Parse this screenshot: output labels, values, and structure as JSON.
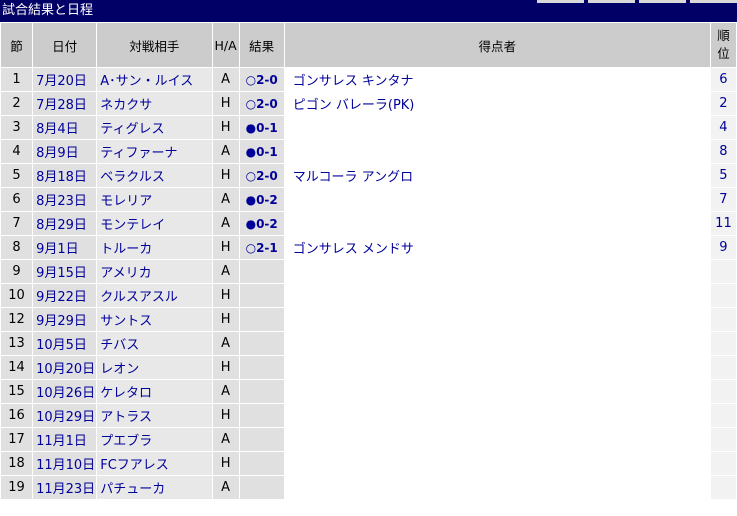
{
  "title": "試合結果と日程",
  "headers": {
    "round": "節",
    "date": "日付",
    "opponent": "対戦相手",
    "ha": "H/A",
    "result": "結果",
    "scorers": "得点者",
    "rank": "順位"
  },
  "rows": [
    {
      "round": "1",
      "date": "7月20日",
      "opponent": "A･サン・ルイス",
      "ha": "A",
      "result": "○2-0",
      "scorers": "ゴンサレス キンタナ",
      "rank": "6"
    },
    {
      "round": "2",
      "date": "7月28日",
      "opponent": "ネカクサ",
      "ha": "H",
      "result": "○2-0",
      "scorers": "ピゴン バレーラ(PK)",
      "rank": "2"
    },
    {
      "round": "3",
      "date": "8月4日",
      "opponent": "ティグレス",
      "ha": "H",
      "result": "●0-1",
      "scorers": "",
      "rank": "4"
    },
    {
      "round": "4",
      "date": "8月9日",
      "opponent": "ティファーナ",
      "ha": "A",
      "result": "●0-1",
      "scorers": "",
      "rank": "8"
    },
    {
      "round": "5",
      "date": "8月18日",
      "opponent": "ベラクルス",
      "ha": "H",
      "result": "○2-0",
      "scorers": "マルコーラ アングロ",
      "rank": "5"
    },
    {
      "round": "6",
      "date": "8月23日",
      "opponent": "モレリア",
      "ha": "A",
      "result": "●0-2",
      "scorers": "",
      "rank": "7"
    },
    {
      "round": "7",
      "date": "8月29日",
      "opponent": "モンテレイ",
      "ha": "A",
      "result": "●0-2",
      "scorers": "",
      "rank": "11"
    },
    {
      "round": "8",
      "date": "9月1日",
      "opponent": "トルーカ",
      "ha": "H",
      "result": "○2-1",
      "scorers": "ゴンサレス メンドサ",
      "rank": "9"
    },
    {
      "round": "9",
      "date": "9月15日",
      "opponent": "アメリカ",
      "ha": "A",
      "result": "",
      "scorers": "",
      "rank": ""
    },
    {
      "round": "10",
      "date": "9月22日",
      "opponent": "クルスアスル",
      "ha": "H",
      "result": "",
      "scorers": "",
      "rank": ""
    },
    {
      "round": "12",
      "date": "9月29日",
      "opponent": "サントス",
      "ha": "H",
      "result": "",
      "scorers": "",
      "rank": ""
    },
    {
      "round": "13",
      "date": "10月5日",
      "opponent": "チバス",
      "ha": "A",
      "result": "",
      "scorers": "",
      "rank": ""
    },
    {
      "round": "14",
      "date": "10月20日",
      "opponent": "レオン",
      "ha": "H",
      "result": "",
      "scorers": "",
      "rank": ""
    },
    {
      "round": "15",
      "date": "10月26日",
      "opponent": "ケレタロ",
      "ha": "A",
      "result": "",
      "scorers": "",
      "rank": ""
    },
    {
      "round": "16",
      "date": "10月29日",
      "opponent": "アトラス",
      "ha": "H",
      "result": "",
      "scorers": "",
      "rank": ""
    },
    {
      "round": "17",
      "date": "11月1日",
      "opponent": "プエブラ",
      "ha": "A",
      "result": "",
      "scorers": "",
      "rank": ""
    },
    {
      "round": "18",
      "date": "11月10日",
      "opponent": "FCフアレス",
      "ha": "H",
      "result": "",
      "scorers": "",
      "rank": ""
    },
    {
      "round": "19",
      "date": "11月23日",
      "opponent": "パチューカ",
      "ha": "A",
      "result": "",
      "scorers": "",
      "rank": ""
    }
  ]
}
